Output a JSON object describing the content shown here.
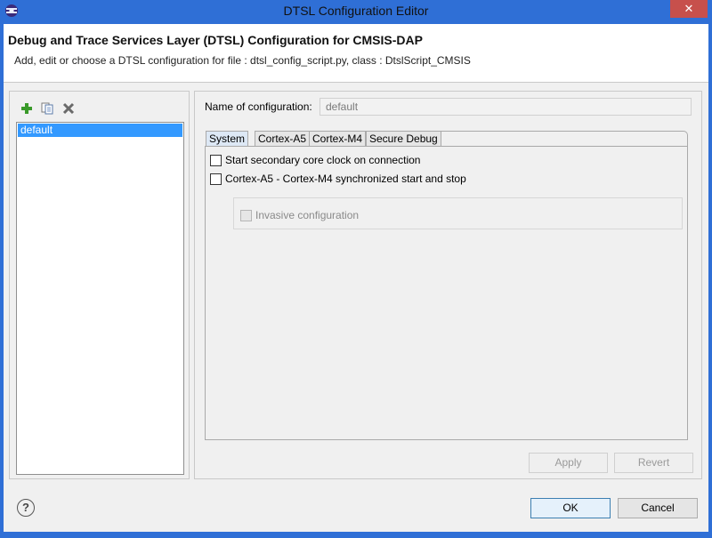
{
  "window": {
    "title": "DTSL Configuration Editor",
    "close_glyph": "✕"
  },
  "header": {
    "title": "Debug and Trace Services Layer (DTSL) Configuration for CMSIS-DAP",
    "description": "Add, edit or choose a DTSL configuration for file : dtsl_config_script.py, class : DtslScript_CMSIS"
  },
  "left_panel": {
    "toolbar": {
      "add_icon": "add-icon",
      "copy_icon": "copy-icon",
      "delete_icon": "delete-icon"
    },
    "configs": [
      "default"
    ]
  },
  "right_panel": {
    "name_label": "Name of configuration:",
    "name_value": "default",
    "tabs": [
      "System",
      "Cortex-A5",
      "Cortex-M4",
      "Secure Debug"
    ],
    "active_tab": "System",
    "options": [
      {
        "label": "Start secondary core clock on connection",
        "checked": false
      },
      {
        "label": "Cortex-A5 - Cortex-M4 synchronized start and stop",
        "checked": false
      }
    ],
    "invasive": {
      "label": "Invasive configuration",
      "checked": false,
      "enabled": false
    },
    "apply_label": "Apply",
    "revert_label": "Revert"
  },
  "footer": {
    "help_glyph": "?",
    "ok_label": "OK",
    "cancel_label": "Cancel"
  },
  "colors": {
    "frame": "#2f6fd6",
    "selection": "#3399ff",
    "close": "#c7504c"
  }
}
